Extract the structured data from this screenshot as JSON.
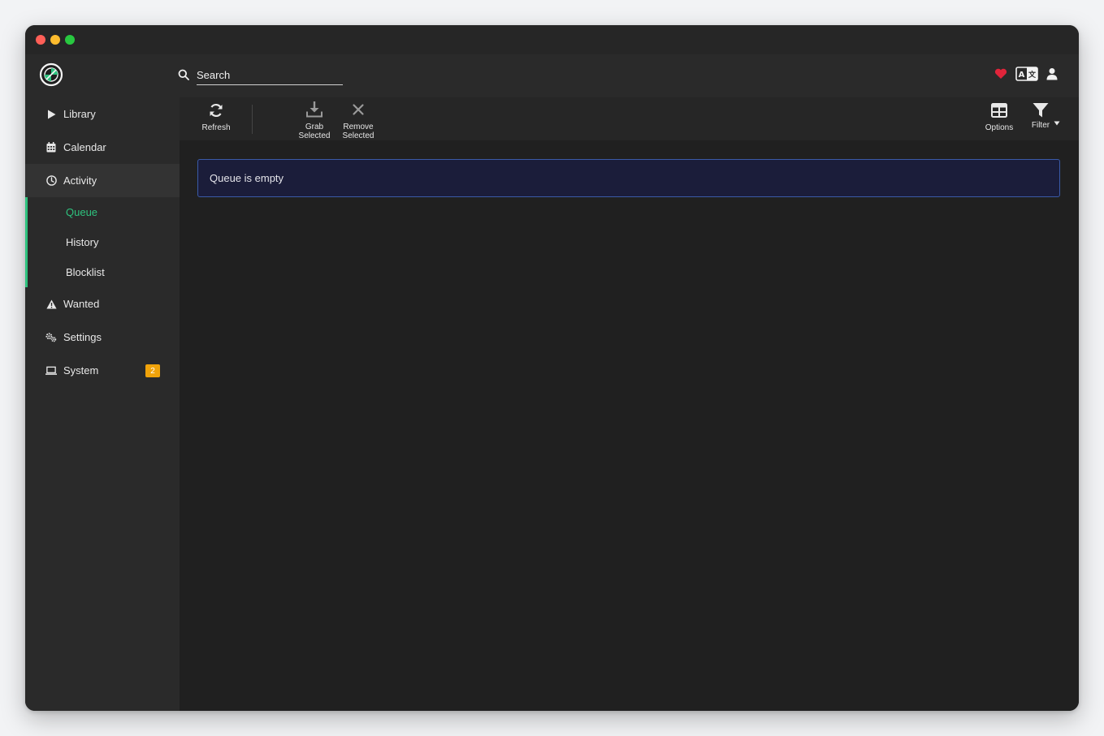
{
  "header": {
    "search_placeholder": "Search"
  },
  "sidebar": {
    "items": [
      {
        "label": "Library",
        "icon": "play-icon"
      },
      {
        "label": "Calendar",
        "icon": "calendar-icon"
      },
      {
        "label": "Activity",
        "icon": "clock-icon"
      },
      {
        "label": "Wanted",
        "icon": "warning-icon"
      },
      {
        "label": "Settings",
        "icon": "cogs-icon"
      },
      {
        "label": "System",
        "icon": "laptop-icon",
        "badge": "2"
      }
    ],
    "activity_sub": [
      {
        "label": "Queue"
      },
      {
        "label": "History"
      },
      {
        "label": "Blocklist"
      }
    ]
  },
  "toolbar": {
    "refresh_label": "Refresh",
    "grab_label_1": "Grab",
    "grab_label_2": "Selected",
    "remove_label_1": "Remove",
    "remove_label_2": "Selected",
    "options_label": "Options",
    "filter_label": "Filter"
  },
  "content": {
    "empty_message": "Queue is empty"
  },
  "colors": {
    "accent": "#2ec27e",
    "badge": "#f0a30a",
    "heart": "#e0243a",
    "alert_bg": "#1b1d3a",
    "alert_border": "#3a5aa8"
  }
}
